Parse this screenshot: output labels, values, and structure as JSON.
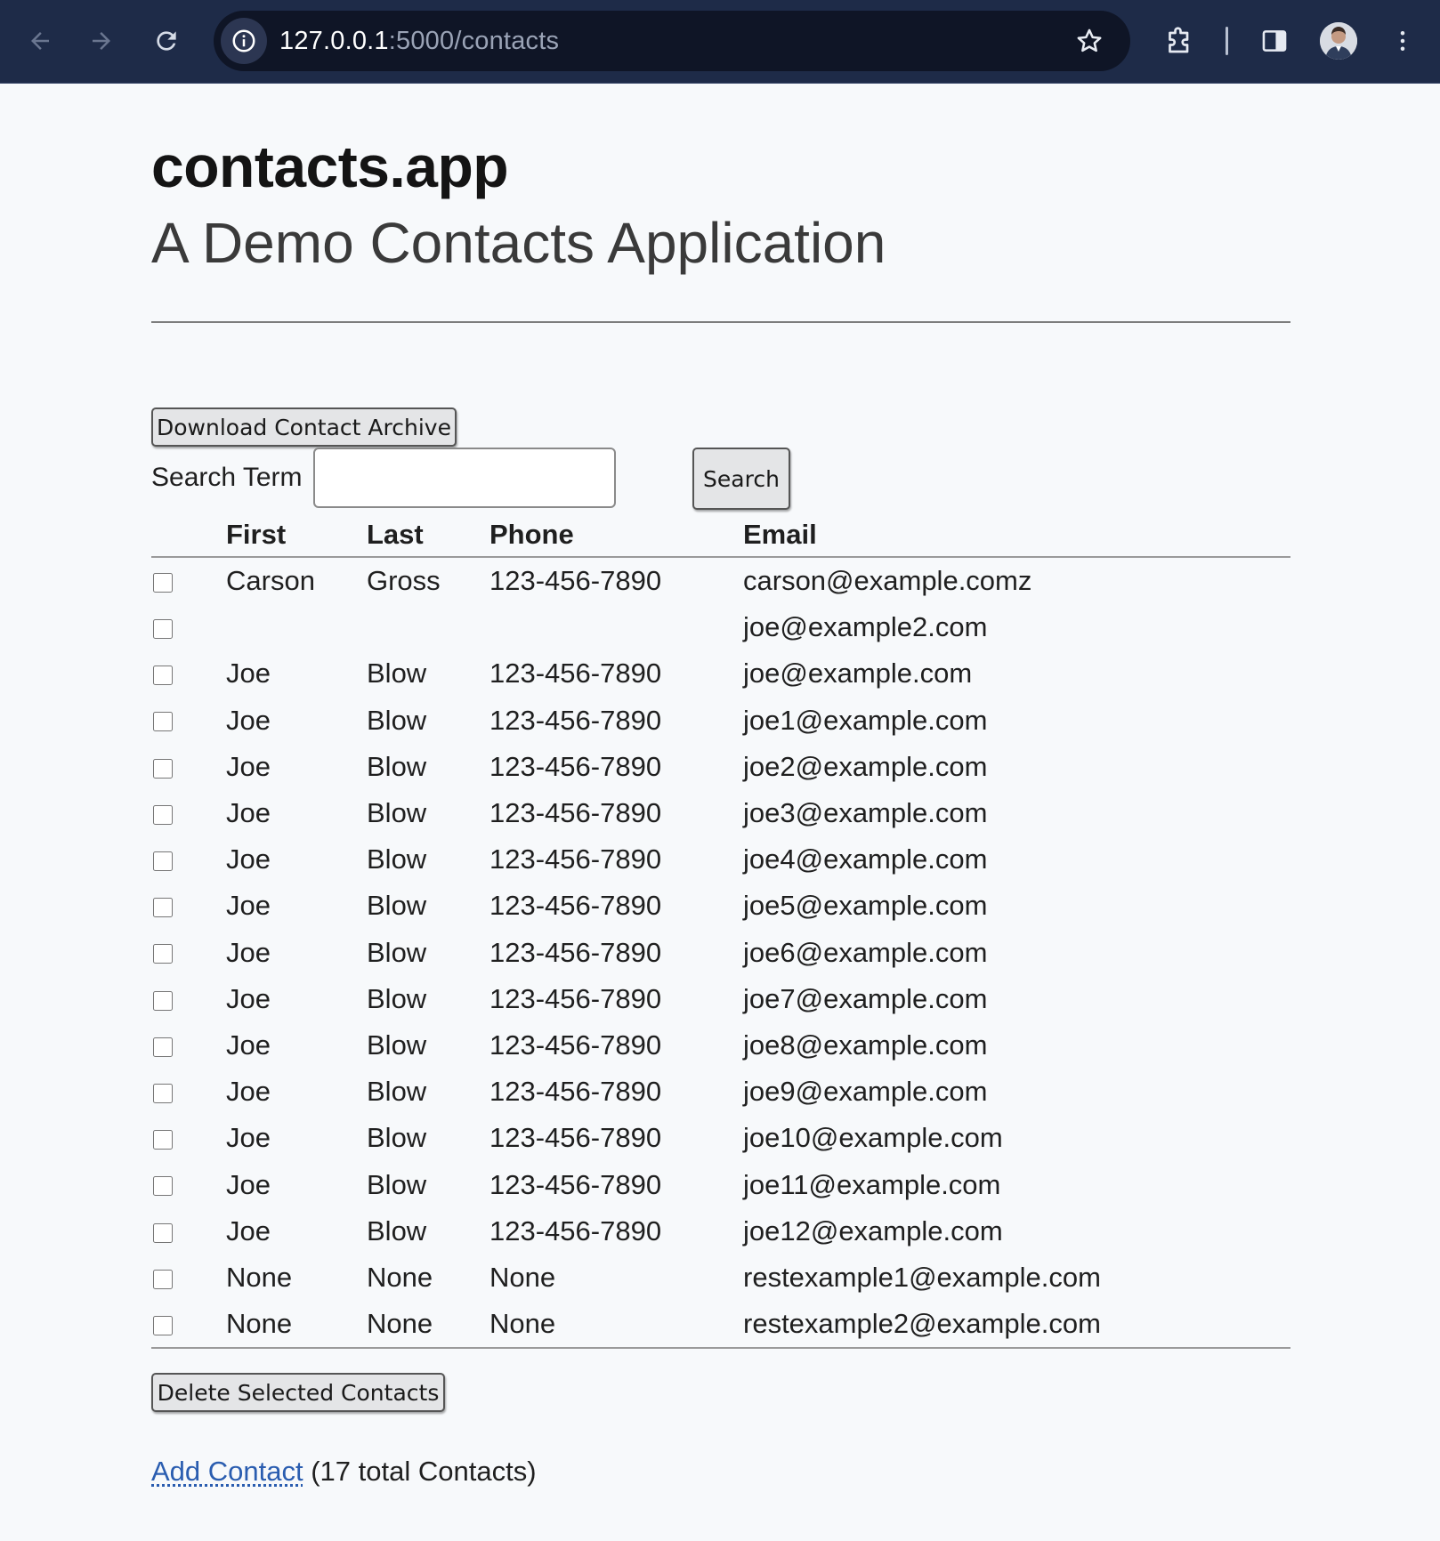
{
  "browser": {
    "url_host": "127.0.0.1",
    "url_path": ":5000/contacts"
  },
  "header": {
    "title": "contacts.app",
    "subtitle": "A Demo Contacts Application"
  },
  "toolbar": {
    "archive_label": "Download Contact Archive",
    "search_label": "Search Term",
    "search_value": "",
    "search_button": "Search"
  },
  "table": {
    "columns": [
      "",
      "First",
      "Last",
      "Phone",
      "Email"
    ],
    "rows": [
      {
        "first": "Carson",
        "last": "Gross",
        "phone": "123-456-7890",
        "email": "carson@example.comz"
      },
      {
        "first": "",
        "last": "",
        "phone": "",
        "email": "joe@example2.com"
      },
      {
        "first": "Joe",
        "last": "Blow",
        "phone": "123-456-7890",
        "email": "joe@example.com"
      },
      {
        "first": "Joe",
        "last": "Blow",
        "phone": "123-456-7890",
        "email": "joe1@example.com"
      },
      {
        "first": "Joe",
        "last": "Blow",
        "phone": "123-456-7890",
        "email": "joe2@example.com"
      },
      {
        "first": "Joe",
        "last": "Blow",
        "phone": "123-456-7890",
        "email": "joe3@example.com"
      },
      {
        "first": "Joe",
        "last": "Blow",
        "phone": "123-456-7890",
        "email": "joe4@example.com"
      },
      {
        "first": "Joe",
        "last": "Blow",
        "phone": "123-456-7890",
        "email": "joe5@example.com"
      },
      {
        "first": "Joe",
        "last": "Blow",
        "phone": "123-456-7890",
        "email": "joe6@example.com"
      },
      {
        "first": "Joe",
        "last": "Blow",
        "phone": "123-456-7890",
        "email": "joe7@example.com"
      },
      {
        "first": "Joe",
        "last": "Blow",
        "phone": "123-456-7890",
        "email": "joe8@example.com"
      },
      {
        "first": "Joe",
        "last": "Blow",
        "phone": "123-456-7890",
        "email": "joe9@example.com"
      },
      {
        "first": "Joe",
        "last": "Blow",
        "phone": "123-456-7890",
        "email": "joe10@example.com"
      },
      {
        "first": "Joe",
        "last": "Blow",
        "phone": "123-456-7890",
        "email": "joe11@example.com"
      },
      {
        "first": "Joe",
        "last": "Blow",
        "phone": "123-456-7890",
        "email": "joe12@example.com"
      },
      {
        "first": "None",
        "last": "None",
        "phone": "None",
        "email": "restexample1@example.com"
      },
      {
        "first": "None",
        "last": "None",
        "phone": "None",
        "email": "restexample2@example.com"
      }
    ]
  },
  "actions": {
    "delete_label": "Delete Selected Contacts"
  },
  "footer": {
    "add_contact": "Add Contact",
    "total_text": "(17 total Contacts)"
  },
  "icons": {
    "back": "back-arrow-icon",
    "forward": "forward-arrow-icon",
    "reload": "reload-icon",
    "site_info": "info-icon",
    "bookmark": "star-icon",
    "extensions": "puzzle-icon",
    "side_panel": "side-panel-icon",
    "profile": "avatar",
    "menu": "kebab-menu-icon"
  },
  "colors": {
    "chrome_bg": "#1e2b48",
    "omnibox_bg": "#0f1526",
    "page_bg": "#f7f9fb",
    "link": "#2a5db0"
  }
}
